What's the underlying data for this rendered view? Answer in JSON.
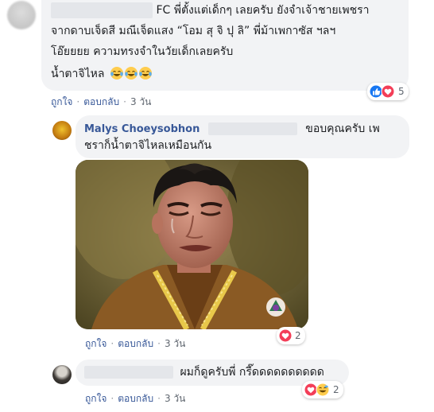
{
  "comments": [
    {
      "name_suffix": "FC",
      "lines": [
        "พี่ตั้งแต่เด็กๆ เลยครับ ยังจำเจ้าชายเพชรา",
        "จากดาบเจ็ดสี มณีเจ็ดแสง “โอม สุ จิ ปุ ลิ” พี่ม้าเพกาซัส ฯลฯ",
        "โอ๊ยยยย ความทรงจำในวัยเด็กเลยครับ",
        "น้ำตาจิไหล"
      ],
      "emoji_name": "laugh-cry-emoji",
      "reaction_count": "5",
      "actions": {
        "like": "ถูกใจ",
        "reply": "ตอบกลับ",
        "time": "3 วัน"
      }
    },
    {
      "author": "Malys Choeysobhon",
      "lines": [
        "ขอบคุณครับ เพ",
        "ชราก็น้ำตาจิไหลเหมือนกัน"
      ],
      "reaction_count": "2",
      "actions": {
        "like": "ถูกใจ",
        "reply": "ตอบกลับ",
        "time": "3 วัน"
      }
    },
    {
      "text": "ผมก็ดูครับพี่ กรี๊ดดดดดดดดดด",
      "reaction_count": "2",
      "actions": {
        "like": "ถูกใจ",
        "reply": "ตอบกลับ",
        "time": "3 วัน"
      }
    }
  ],
  "colors": {
    "link": "#385898",
    "bubble": "#f2f3f5",
    "like_blue": "#1877f2",
    "love_red": "#f33e58",
    "emoji_yellow": "#ffcc4d"
  }
}
